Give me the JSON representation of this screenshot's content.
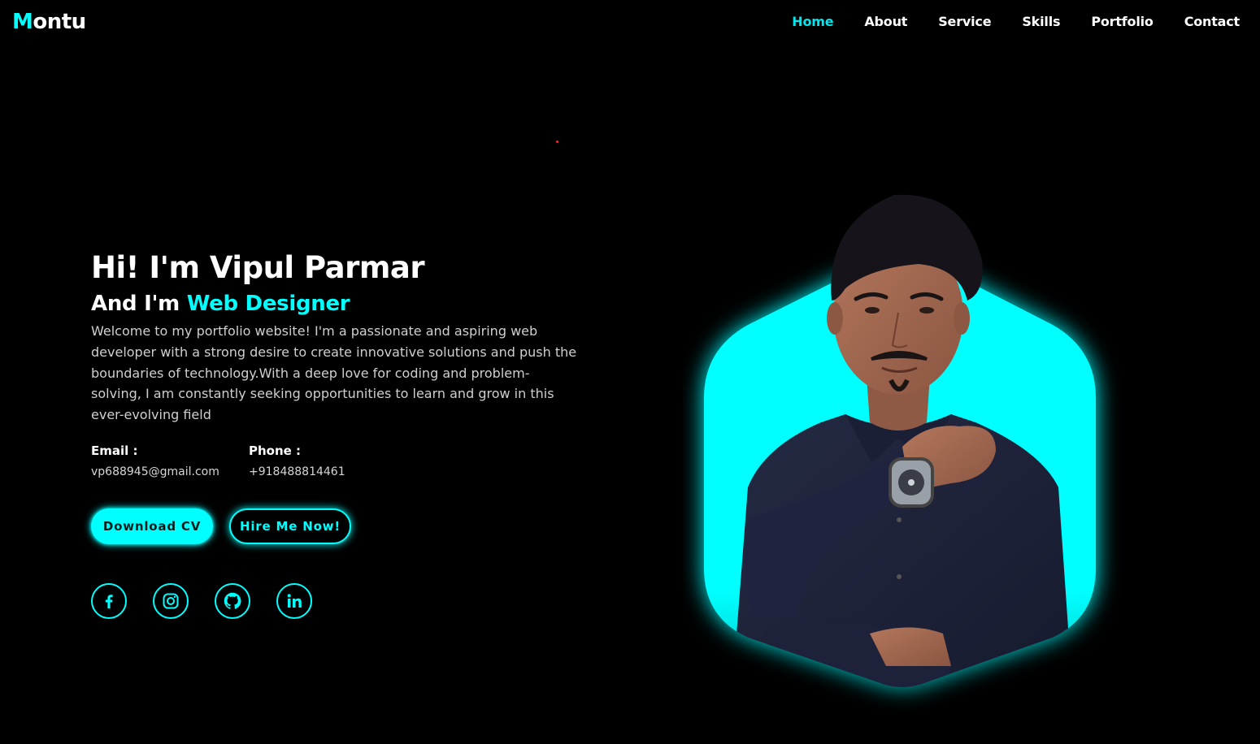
{
  "brand": {
    "logo_initial": "M",
    "logo_rest": "ontu"
  },
  "nav": {
    "items": [
      "Home",
      "About",
      "Service",
      "Skills",
      "Portfolio",
      "Contact"
    ],
    "active": "Home"
  },
  "hero": {
    "greeting": "Hi! I'm Vipul Parmar",
    "role_prefix": "And I'm ",
    "role": "Web Designer",
    "description": "Welcome to my portfolio website! I'm a passionate and aspiring web developer with a strong desire to create innovative solutions and push the boundaries of technology.With a deep love for coding and problem-solving, I am constantly seeking opportunities to learn and grow in this ever-evolving field"
  },
  "contact": {
    "email_label": "Email :",
    "email": "vp688945@gmail.com",
    "phone_label": "Phone :",
    "phone": "+918488814461"
  },
  "buttons": {
    "download": "Download CV",
    "hire": "Hire Me Now!"
  },
  "socials": [
    "facebook-icon",
    "instagram-icon",
    "github-icon",
    "linkedin-icon"
  ],
  "colors": {
    "accent": "#00ffff",
    "background": "#000000",
    "text": "#ffffff"
  }
}
